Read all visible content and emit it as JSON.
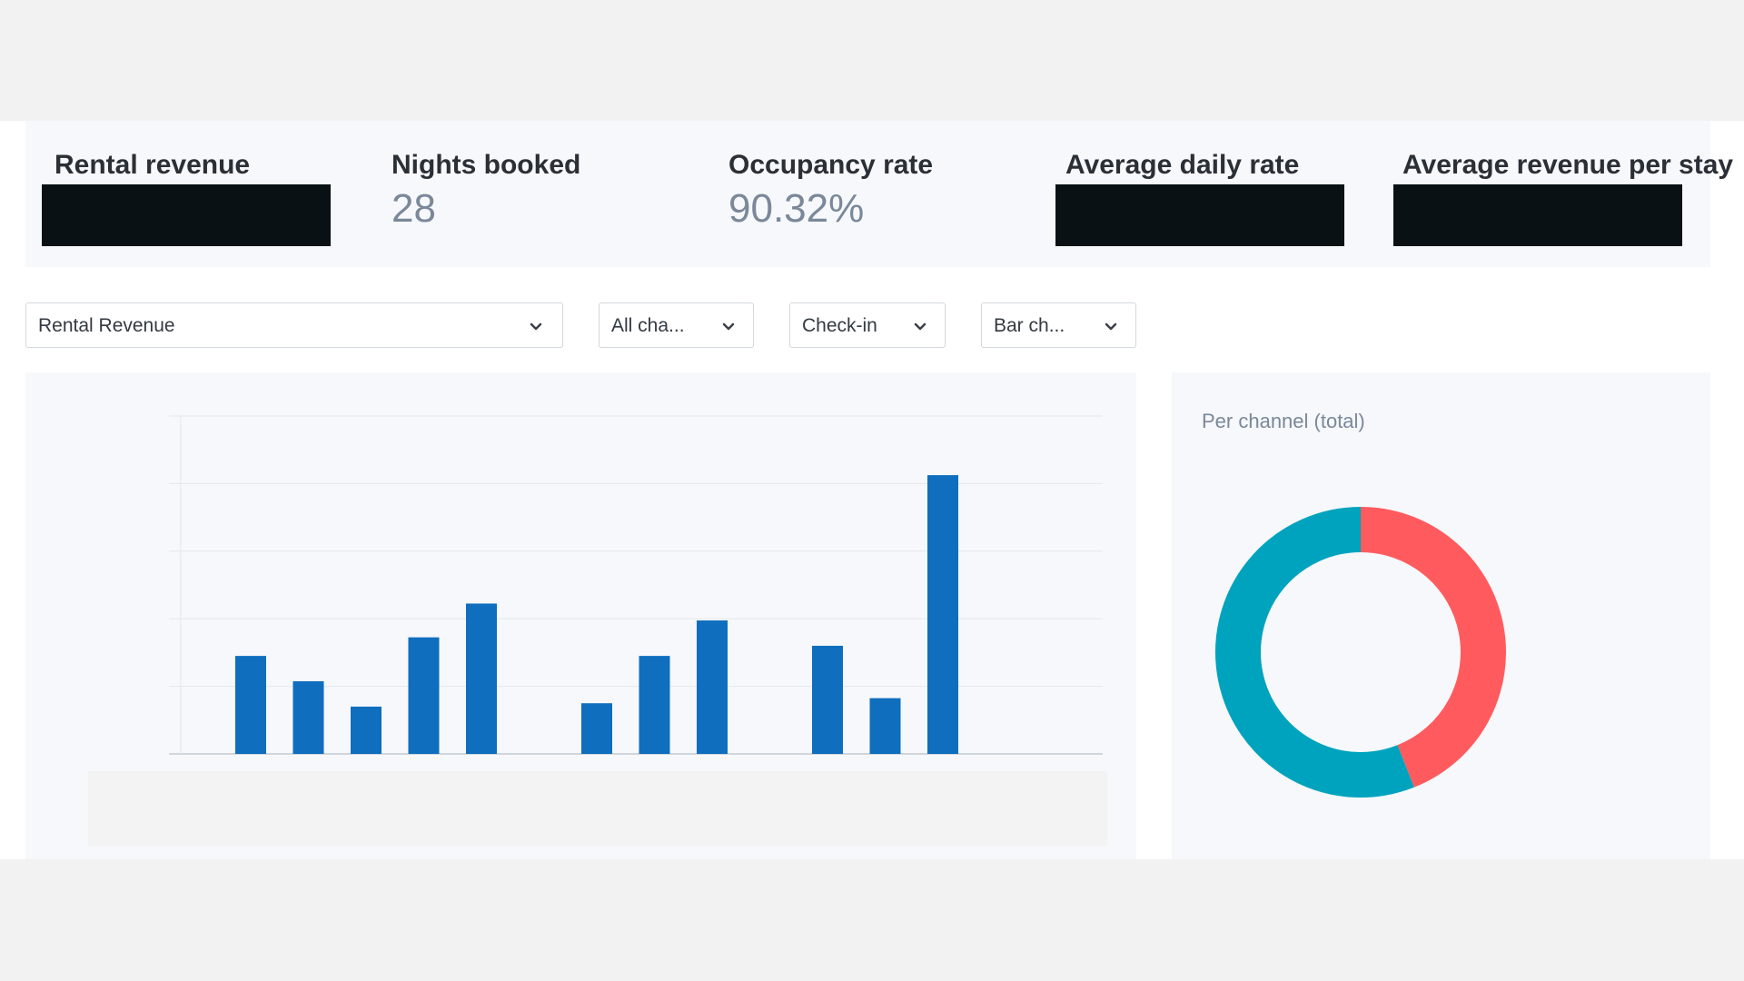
{
  "stats": [
    {
      "label": "Rental revenue",
      "value": null,
      "redacted": true
    },
    {
      "label": "Nights booked",
      "value": "28",
      "redacted": false
    },
    {
      "label": "Occupancy rate",
      "value": "90.32%",
      "redacted": false
    },
    {
      "label": "Average daily rate",
      "value": null,
      "redacted": true
    },
    {
      "label": "Average revenue per stay",
      "value": null,
      "redacted": true
    }
  ],
  "filters": {
    "metric": "Rental Revenue",
    "channel": "All cha...",
    "date_type": "Check-in",
    "chart_type": "Bar ch..."
  },
  "icons": {
    "dropdown": "chevron-down-icon"
  },
  "chart_data": [
    {
      "type": "bar",
      "categories": [
        "",
        "",
        "",
        "",
        "",
        "",
        "",
        "",
        "",
        "",
        "",
        "",
        "",
        ""
      ],
      "values": [
        29,
        21.5,
        14,
        34.5,
        44.5,
        0,
        15,
        29,
        39.5,
        0,
        32,
        16.5,
        82.5,
        0
      ],
      "ylim": [
        0,
        100
      ],
      "grid": true,
      "color": "#106ebe"
    },
    {
      "type": "pie",
      "title": "Per channel (total)",
      "values": [
        44,
        56
      ],
      "colors": [
        "#ff5b5e",
        "#00a3bd"
      ],
      "donut": true
    }
  ]
}
